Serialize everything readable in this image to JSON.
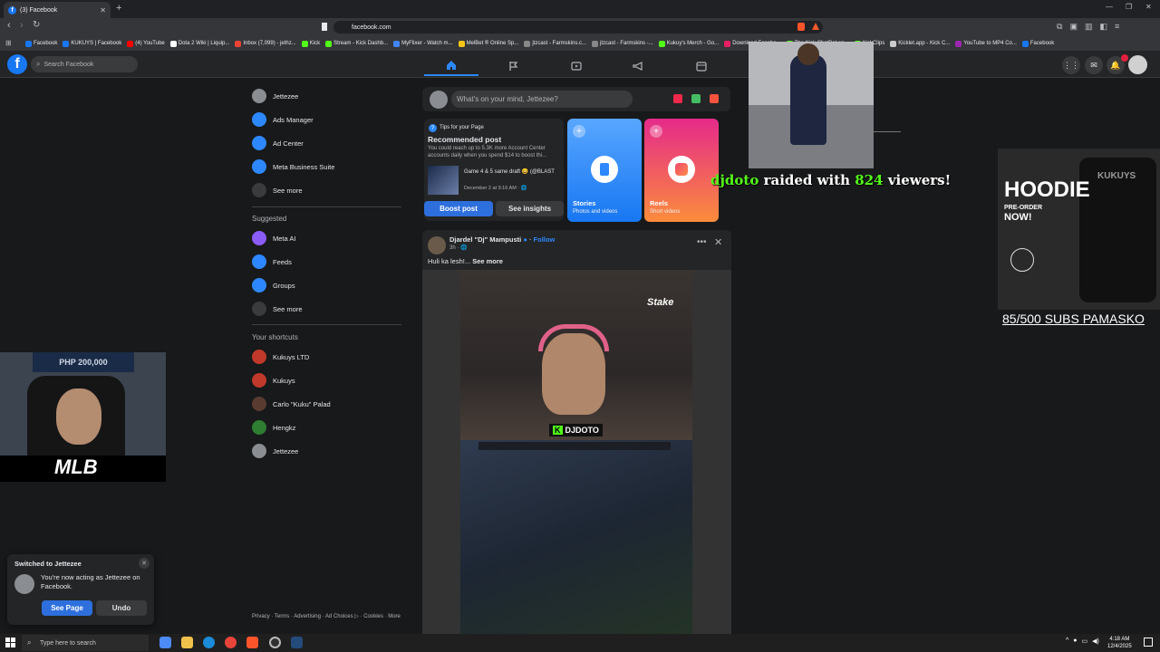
{
  "browser": {
    "tab_title": "(3) Facebook",
    "url": "facebook.com",
    "bookmarks": [
      {
        "label": "Facebook",
        "color": "#1877f2"
      },
      {
        "label": "KUKUYS | Facebook",
        "color": "#1877f2"
      },
      {
        "label": "(4) YouTube",
        "color": "#ff0000"
      },
      {
        "label": "Dota 2 Wiki | Liquip...",
        "color": "#ffffff"
      },
      {
        "label": "Inbox (7,099) - jethz...",
        "color": "#ea4335"
      },
      {
        "label": "Kick",
        "color": "#53fc18"
      },
      {
        "label": "Stream - Kick Dashb...",
        "color": "#53fc18"
      },
      {
        "label": "MyFlixer - Watch m...",
        "color": "#4285f4"
      },
      {
        "label": "MelBet ® Online Sp...",
        "color": "#f5c518"
      },
      {
        "label": "jtzcast - Farmskins.c...",
        "color": "#888888"
      },
      {
        "label": "jtzcast - Farmskins -...",
        "color": "#888888"
      },
      {
        "label": "Kukuy's Merch - Go...",
        "color": "#53fc18"
      },
      {
        "label": "Download Facebo...",
        "color": "#e91e63"
      },
      {
        "label": "The Kick ChatBot an...",
        "color": "#53fc18"
      },
      {
        "label": "KickClips",
        "color": "#53fc18"
      },
      {
        "label": "Kicklet.app - Kick C...",
        "color": "#cccccc"
      },
      {
        "label": "YouTube to MP4 Co...",
        "color": "#9c27b0"
      },
      {
        "label": "Facebook",
        "color": "#1877f2"
      }
    ]
  },
  "fb": {
    "search_placeholder": "Search Facebook",
    "sidebar": [
      {
        "label": "Jettezee",
        "icon": "avatar"
      },
      {
        "label": "Ads Manager",
        "icon": "ads-manager-icon"
      },
      {
        "label": "Ad Center",
        "icon": "ad-center-icon"
      },
      {
        "label": "Meta Business Suite",
        "icon": "business-suite-icon"
      },
      {
        "label": "See more",
        "icon": "chevron-down-icon"
      }
    ],
    "suggested_heading": "Suggested",
    "suggested": [
      {
        "label": "Meta AI"
      },
      {
        "label": "Feeds"
      },
      {
        "label": "Groups"
      },
      {
        "label": "See more"
      }
    ],
    "shortcuts_heading": "Your shortcuts",
    "shortcuts": [
      {
        "label": "Kukuys LTD"
      },
      {
        "label": "Kukuys"
      },
      {
        "label": "Carlo \"Kuku\" Palad"
      },
      {
        "label": "Hengkz"
      },
      {
        "label": "Jettezee"
      }
    ],
    "footer": "Privacy · Terms · Advertising · Ad Choices ▷ · Cookies · More",
    "composer_placeholder": "What's on your mind, Jettezee?",
    "tips": {
      "header": "Tips for your Page",
      "title": "Recommended post",
      "body": "You could reach up to 5.3K more Account Center accounts daily when you spend $14 to boost thi...",
      "post_title": "Game 4 & 5 same draft 😄 (@BLAST",
      "post_date": "December 2 at 9:16 AM · 🌐",
      "boost_label": "Boost post",
      "insights_label": "See insights"
    },
    "stories": {
      "title": "Stories",
      "sub": "Photos and videos"
    },
    "reels": {
      "title": "Reels",
      "sub": "Short videos"
    },
    "post": {
      "author": "Djardel \"Dj\" Mampusti",
      "follow": "Follow",
      "time": "3h · 🌐",
      "text": "Huli ka lesh!... ",
      "see_more": "See more",
      "video_badge": "DJDOTO",
      "sponsor": "Stake"
    },
    "toast": {
      "title": "Switched to Jettezee",
      "body": "You're now acting as Jettezee on Facebook.",
      "see_page": "See Page",
      "undo": "Undo"
    }
  },
  "overlays": {
    "raid_user": "djdoto",
    "raid_mid": " raided with ",
    "raid_count": "824",
    "raid_end": " viewers!",
    "hoodie_title": "HOODIE",
    "hoodie_pre": "PRE-ORDER",
    "hoodie_now": "NOW!",
    "hoodie_brand": "KUKUYS",
    "subs": "85/500 SUBS PAMASKO",
    "webcam_banner": "PHP 200,000",
    "webcam_logo": "MLB"
  },
  "taskbar": {
    "search_placeholder": "Type here to search",
    "time": "4:18 AM",
    "date": "12/4/2025"
  }
}
